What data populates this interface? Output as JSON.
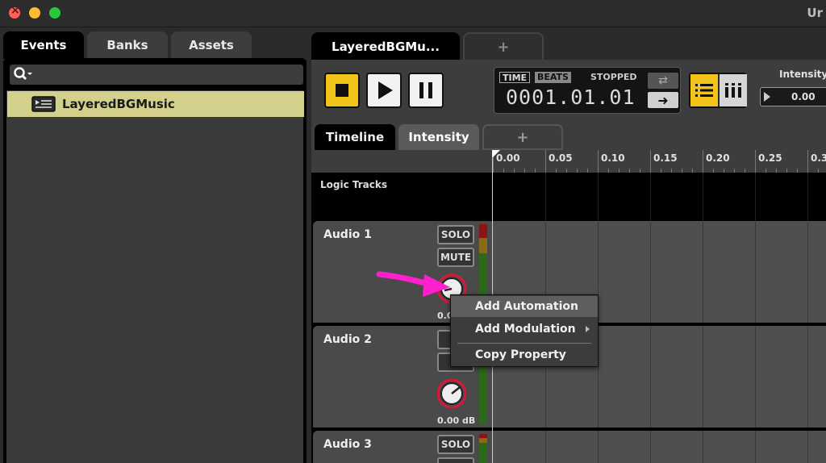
{
  "window": {
    "title": "Ur"
  },
  "left_tabs": [
    {
      "label": "Events",
      "active": true
    },
    {
      "label": "Banks",
      "active": false
    },
    {
      "label": "Assets",
      "active": false
    }
  ],
  "browser": {
    "search": {
      "value": "",
      "placeholder": ""
    },
    "items": [
      {
        "label": "LayeredBGMusic",
        "selected": true
      }
    ]
  },
  "editor_tabs": {
    "active_label": "LayeredBGMu...",
    "add_label": "+"
  },
  "transport": {
    "time_label": "TIME",
    "beats_label": "BEATS",
    "status": "STOPPED",
    "position": "0001.01.01",
    "loop_symbol": "⇄",
    "follow_symbol": "➜"
  },
  "parameter": {
    "name": "Intensity",
    "value": "0.00"
  },
  "sub_tabs": [
    {
      "label": "Timeline",
      "active": false
    },
    {
      "label": "Intensity",
      "active": true
    },
    {
      "label": "+",
      "active": false
    }
  ],
  "ruler": {
    "ticks": [
      "0.00",
      "0.05",
      "0.10",
      "0.15",
      "0.20",
      "0.25",
      "0.3"
    ]
  },
  "logic_tracks_label": "Logic Tracks",
  "tracks": [
    {
      "name": "Audio 1",
      "solo": "SOLO",
      "mute": "MUTE",
      "volume": "0.0"
    },
    {
      "name": "Audio 2",
      "solo": "S",
      "mute": "M",
      "volume": "0.00 dB"
    },
    {
      "name": "Audio 3",
      "solo": "SOLO",
      "mute": "",
      "volume": ""
    }
  ],
  "context_menu": {
    "items": [
      {
        "label": "Add Automation",
        "hover": true
      },
      {
        "label": "Add Modulation",
        "submenu": true
      },
      {
        "label": "Copy Property"
      }
    ]
  },
  "colors": {
    "accent_yellow": "#f2c419",
    "selection": "#d2d08a",
    "annotation_arrow": "#ff1fce",
    "knob_ring": "#d8183a"
  }
}
